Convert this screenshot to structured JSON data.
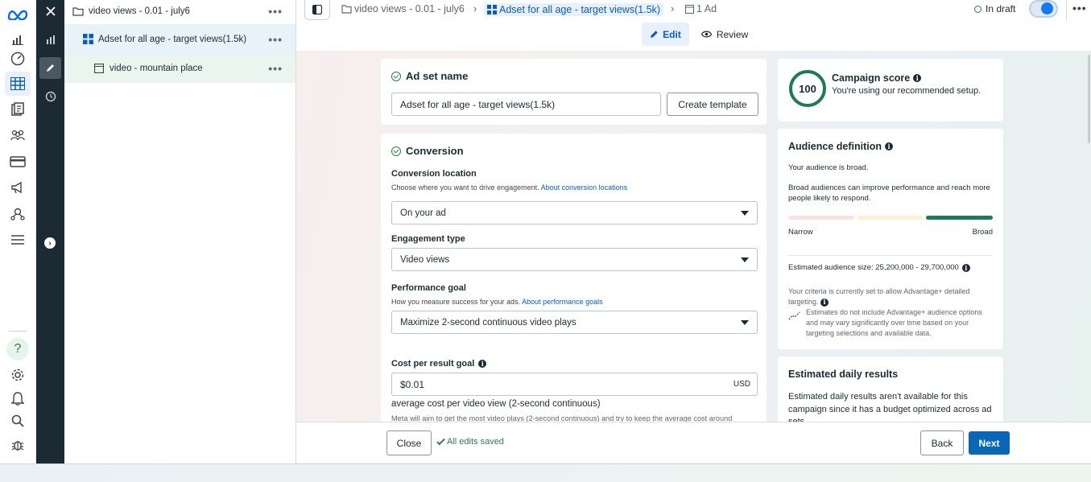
{
  "tree": {
    "campaign": "video views - 0.01 - july6",
    "adset": "Adset for all age - target views(1.5k)",
    "ad": "video - mountain place",
    "more": "•••"
  },
  "breadcrumb": {
    "campaign": "video views - 0.01 - july6",
    "adset": "Adset for all age - target views(1.5k)",
    "ad": "1 Ad"
  },
  "status": {
    "draft": "In draft",
    "more": "•••"
  },
  "tabs": {
    "edit": "Edit",
    "review": "Review"
  },
  "adset_name": {
    "title": "Ad set name",
    "value": "Adset for all age - target views(1.5k)",
    "create_template": "Create template"
  },
  "conversion": {
    "title": "Conversion",
    "location_label": "Conversion location",
    "location_help": "Choose where you want to drive engagement.",
    "location_link": "About conversion locations",
    "location_value": "On your ad",
    "engagement_label": "Engagement type",
    "engagement_value": "Video views",
    "goal_label": "Performance goal",
    "goal_help": "How you measure success for your ads.",
    "goal_link": "About performance goals",
    "goal_value": "Maximize 2-second continuous video plays",
    "cost_label": "Cost per result goal",
    "cost_value": "$0.01",
    "cost_currency": "USD",
    "cost_sub": "average cost per video view (2-second continuous)",
    "cost_note": "Meta will aim to get the most video plays (2-second continuous) and try to keep the average cost around"
  },
  "campaign_score": {
    "score": "100",
    "title": "Campaign score",
    "desc": "You're using our recommended setup."
  },
  "audience": {
    "title": "Audience definition",
    "broad_text": "Your audience is broad.",
    "broad_desc": "Broad audiences can improve performance and reach more people likely to respond.",
    "narrow": "Narrow",
    "broad": "Broad",
    "size": "Estimated audience size: 25,200,000 - 29,700,000",
    "criteria": "Your criteria is currently set to allow Advantage+ detailed targeting.",
    "estimates": "Estimates do not include Advantage+ audience options and may vary significantly over time based on your targeting selections and available data."
  },
  "daily_results": {
    "title": "Estimated daily results",
    "desc": "Estimated daily results aren't available for this campaign since it has a budget optimized across ad sets."
  },
  "footer": {
    "close": "Close",
    "saved": "All edits saved",
    "back": "Back",
    "next": "Next"
  },
  "colors": {
    "brand": "#0a67b8",
    "success": "#2e7d4a",
    "sidebar_dark": "#1c2b33",
    "meter_narrow": "#fbe2e2",
    "meter_mid": "#fbf1d6",
    "meter_broad": "#1e7b57"
  }
}
